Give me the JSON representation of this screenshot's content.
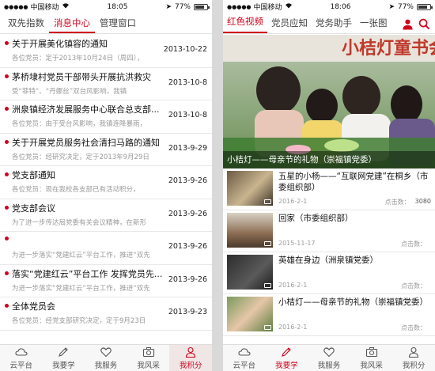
{
  "status_left": {
    "carrier": "中国移动",
    "time": "18:05",
    "battery": "77%"
  },
  "status_right": {
    "carrier": "中国移动",
    "time": "18:06",
    "battery": "77%"
  },
  "left_tabs": [
    "双先指数",
    "消息中心",
    "管理窗口"
  ],
  "news": [
    {
      "title": "关于开展美化镇容的通知",
      "summary": "各位党员：定于2013年10月24日（周四），",
      "date": "2013-10-22"
    },
    {
      "title": "茅桥埭村党员干部带头开展抗洪救灾",
      "summary": "受“菲特”、“丹娜丝”双台风影响，我镇",
      "date": "2013-10-8"
    },
    {
      "title": "洲泉镇经济发展服务中心联合总支部...",
      "summary": "各位党员：由于受台风影响，我镇连降暴雨，",
      "date": "2013-10-8"
    },
    {
      "title": "关于开展党员服务社会清扫马路的通知",
      "summary": "各位党员：经研究决定，定于2013年9月29日",
      "date": "2013-9-29"
    },
    {
      "title": "党支部通知",
      "summary": "各位党员：现在我校各支部已有活动积分，",
      "date": "2013-9-26"
    },
    {
      "title": "党支部会议",
      "summary": "为了进一步传达局党委有关会议精神，在新形",
      "date": "2013-9-26"
    },
    {
      "title": "",
      "summary": "为进一步落实“党建红云”平台工作，推进“双先",
      "date": "2013-9-26"
    },
    {
      "title": "落实“党建红云”平台工作 发挥党员先...",
      "summary": "为进一步落实“党建红云”平台工作，推进“双先",
      "date": "2013-9-26"
    },
    {
      "title": "全体党员会",
      "summary": "各位党员：经党支部研究决定，定于9月23日",
      "date": "2013-9-23"
    }
  ],
  "nav": [
    "云平台",
    "我要学",
    "我服务",
    "我风采",
    "我积分"
  ],
  "right_tabs": [
    "红色视频",
    "党员应知",
    "党务助手",
    "一张图"
  ],
  "hero": {
    "sign_text": "小桔灯童书会",
    "caption": "小桔灯——母亲节的礼物（崇福镇党委）"
  },
  "videos": [
    {
      "title": "五星的小杨——“互联网党建”在桐乡（市委组织部）",
      "date": "2016-2-1",
      "clicks_label": "点击数：",
      "clicks": "3080"
    },
    {
      "title": "回家（市委组织部）",
      "date": "2015-11-17",
      "clicks_label": "点击数：",
      "clicks": ""
    },
    {
      "title": "英雄在身边（洲泉镇党委）",
      "date": "2016-2-1",
      "clicks_label": "点击数：",
      "clicks": ""
    },
    {
      "title": "小桔灯——母亲节的礼物（崇福镇党委）",
      "date": "2016-2-1",
      "clicks_label": "点击数：",
      "clicks": ""
    }
  ],
  "colors": {
    "accent": "#d0021b",
    "muted": "#9a9a9a"
  }
}
